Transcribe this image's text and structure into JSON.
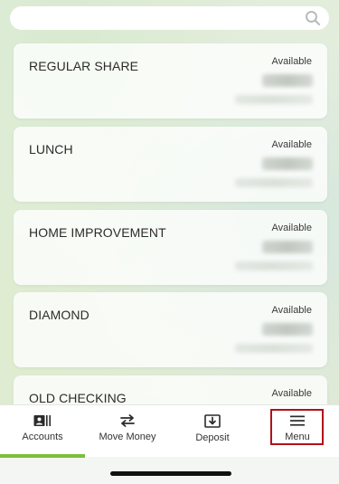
{
  "search": {
    "placeholder": ""
  },
  "accounts": [
    {
      "name": "REGULAR SHARE",
      "available_label": "Available"
    },
    {
      "name": "LUNCH",
      "available_label": "Available"
    },
    {
      "name": "HOME IMPROVEMENT",
      "available_label": "Available"
    },
    {
      "name": "DIAMOND",
      "available_label": "Available"
    },
    {
      "name": "OLD CHECKING",
      "available_label": "Available"
    }
  ],
  "tabs": [
    {
      "label": "Accounts",
      "icon": "accounts-icon",
      "active": true
    },
    {
      "label": "Move Money",
      "icon": "transfer-arrows-icon",
      "active": false
    },
    {
      "label": "Deposit",
      "icon": "deposit-icon",
      "active": false
    },
    {
      "label": "Menu",
      "icon": "hamburger-menu-icon",
      "active": false
    }
  ],
  "colors": {
    "active_tab_indicator": "#7bbf3a",
    "highlight_outline": "#b0121a"
  }
}
